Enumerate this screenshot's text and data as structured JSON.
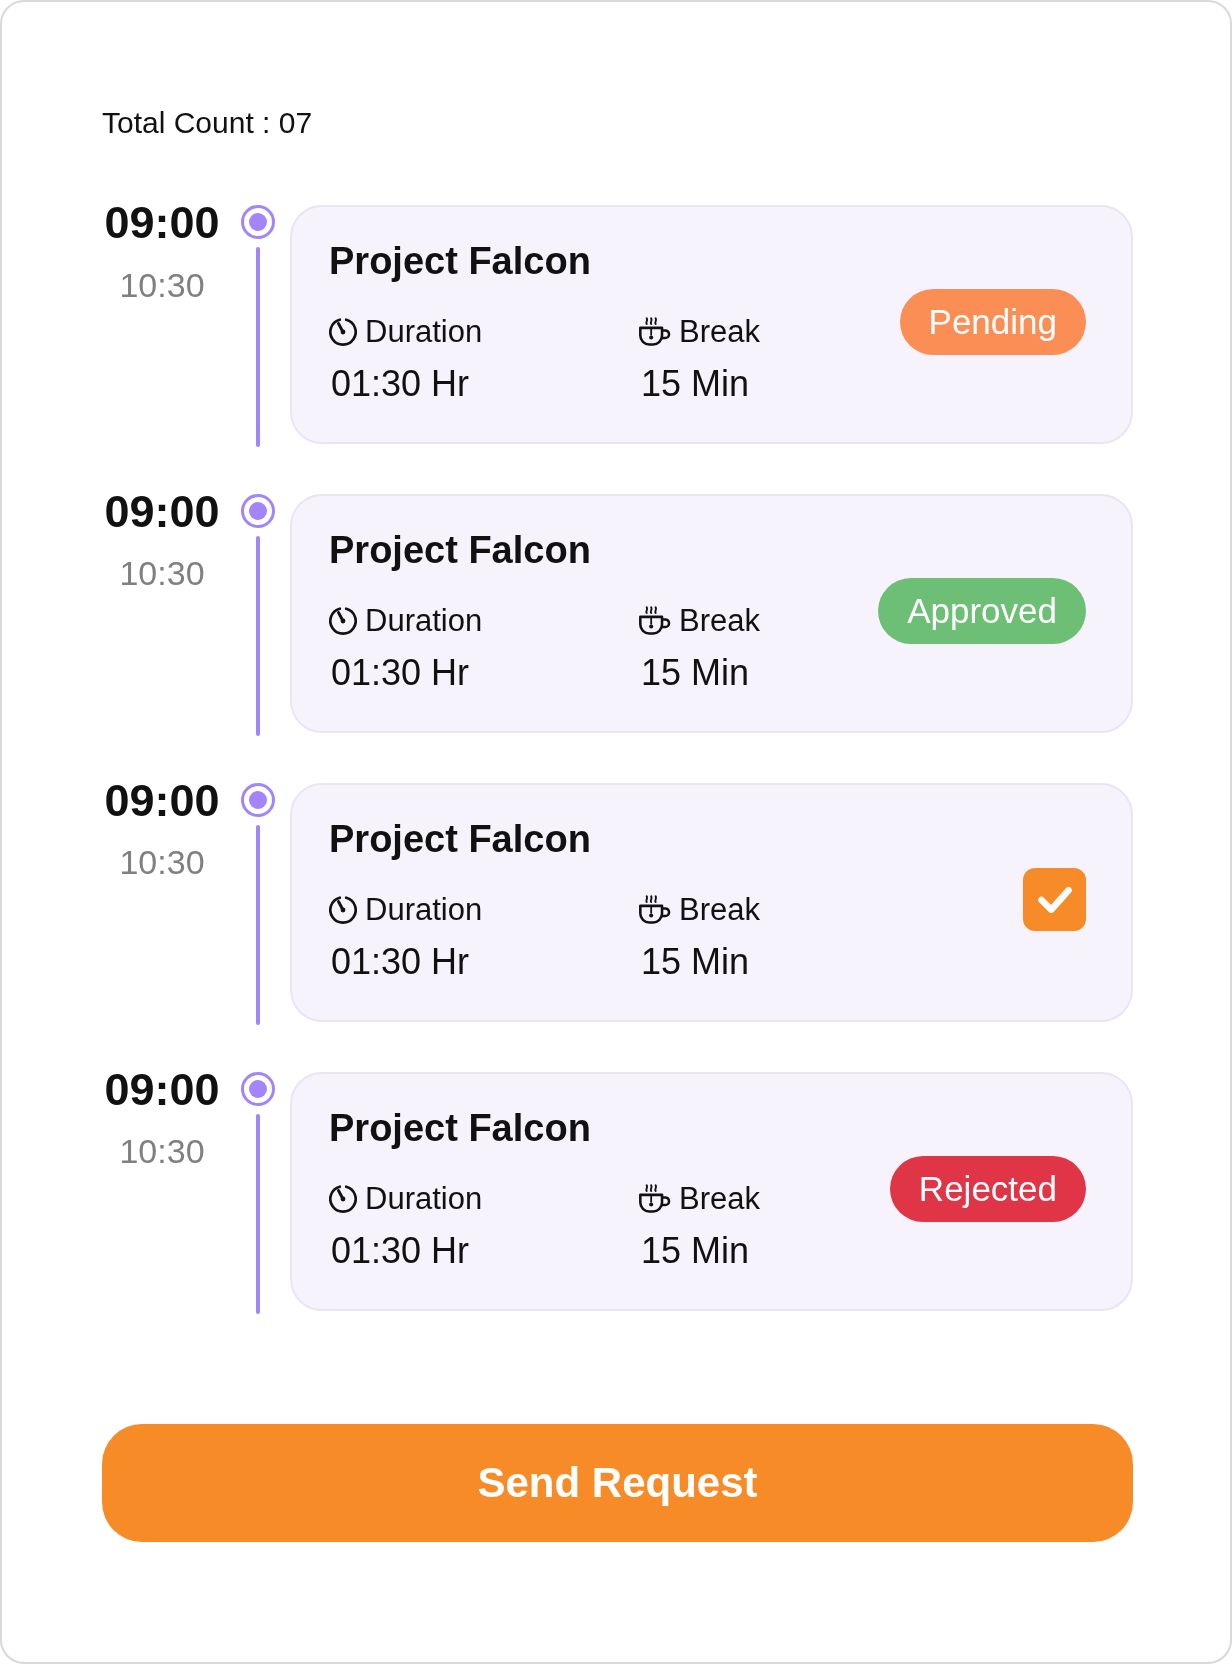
{
  "total_count": "Total Count : 07",
  "entries": [
    {
      "start": "09:00",
      "end": "10:30",
      "title": "Project Falcon",
      "duration_label": "Duration",
      "duration": "01:30 Hr",
      "break_label": "Break",
      "break": "15 Min",
      "status": {
        "kind": "badge",
        "label": "Pending",
        "color": "#fb8e55"
      }
    },
    {
      "start": "09:00",
      "end": "10:30",
      "title": "Project Falcon",
      "duration_label": "Duration",
      "duration": "01:30 Hr",
      "break_label": "Break",
      "break": "15 Min",
      "status": {
        "kind": "badge",
        "label": "Approved",
        "color": "#6cbf74"
      }
    },
    {
      "start": "09:00",
      "end": "10:30",
      "title": "Project Falcon",
      "duration_label": "Duration",
      "duration": "01:30 Hr",
      "break_label": "Break",
      "break": "15 Min",
      "status": {
        "kind": "checkbox",
        "checked": true
      }
    },
    {
      "start": "09:00",
      "end": "10:30",
      "title": "Project Falcon",
      "duration_label": "Duration",
      "duration": "01:30 Hr",
      "break_label": "Break",
      "break": "15 Min",
      "status": {
        "kind": "badge",
        "label": "Rejected",
        "color": "#e03547"
      }
    }
  ],
  "send_button": "Send Request"
}
